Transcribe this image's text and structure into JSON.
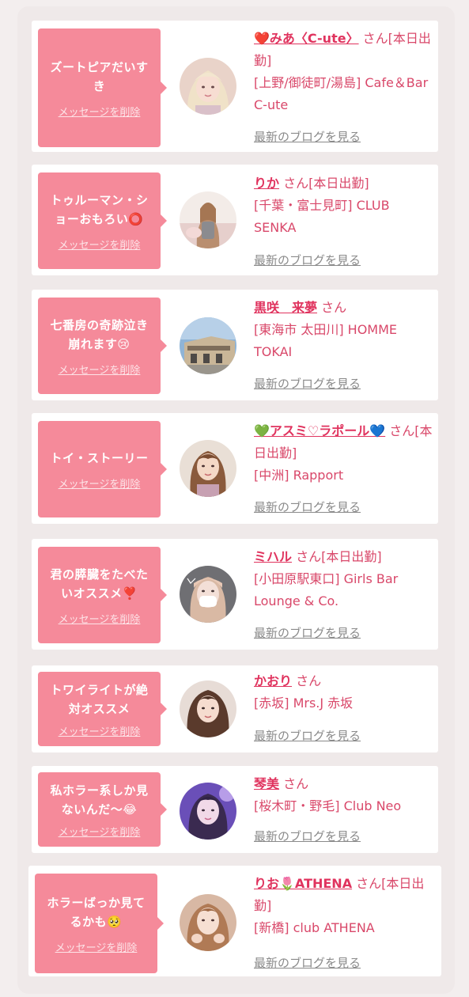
{
  "items": [
    {
      "message": "ズートピアだいすき",
      "delete_label": "メッセージを削除",
      "name": "❤️みあ〈C-ute〉",
      "suffix": "さん[本日出勤]",
      "store": "[上野/御徒町/湯島] Cafe＆Bar C-ute",
      "blog_label": "最新のブログを見る",
      "avatar_icon": "woman-avatar-blonde"
    },
    {
      "message": "トゥルーマン・ショーおもろい⭕",
      "delete_label": "メッセージを削除",
      "name": "りか",
      "suffix": "さん[本日出勤]",
      "store": "[千葉・富士見町] CLUB SENKA",
      "blog_label": "最新のブログを見る",
      "avatar_icon": "woman-avatar-seated"
    },
    {
      "message": "七番房の奇跡泣き崩れます😢",
      "delete_label": "メッセージを削除",
      "name": "黒咲　来夢",
      "suffix": "さん",
      "store": "[東海市 太田川] HOMME TOKAI",
      "blog_label": "最新のブログを見る",
      "avatar_icon": "building-photo"
    },
    {
      "message": "トイ・ストーリー",
      "delete_label": "メッセージを削除",
      "name": "💚アスミ♡ラポール💙",
      "suffix": "さん[本日出勤]",
      "store": "[中洲] Rapport",
      "blog_label": "最新のブログを見る",
      "avatar_icon": "woman-avatar-brown-hair"
    },
    {
      "message": "君の膵臓をたべたいオススメ❣️",
      "delete_label": "メッセージを削除",
      "name": "ミハル",
      "suffix": "さん[本日出勤]",
      "store": "[小田原駅東口] Girls Bar Lounge & Co.",
      "blog_label": "最新のブログを見る",
      "avatar_icon": "woman-avatar-mask"
    },
    {
      "message": "トワイライトが絶対オススメ",
      "delete_label": "メッセージを削除",
      "name": "かおり",
      "suffix": "さん",
      "store": "[赤坂] Mrs.J 赤坂",
      "blog_label": "最新のブログを見る",
      "avatar_icon": "woman-avatar-long-hair"
    },
    {
      "message": "私ホラー系しか見ないんだ〜😂",
      "delete_label": "メッセージを削除",
      "name": "琴美",
      "suffix": "さん",
      "store": "[桜木町・野毛] Club Neo",
      "blog_label": "最新のブログを見る",
      "avatar_icon": "woman-avatar-purple-light"
    },
    {
      "message": "ホラーばっか見てるかも🥺",
      "delete_label": "メッセージを削除",
      "name": "りお🌷ATHENA",
      "suffix": "さん[本日出勤]",
      "store": "[新橋] club ATHENA",
      "blog_label": "最新のブログを見る",
      "avatar_icon": "woman-avatar-hands"
    }
  ],
  "colors": {
    "bubble": "#f58a9a",
    "name": "#e0335e",
    "text": "#d9486a",
    "blog": "#8a8a8a"
  }
}
